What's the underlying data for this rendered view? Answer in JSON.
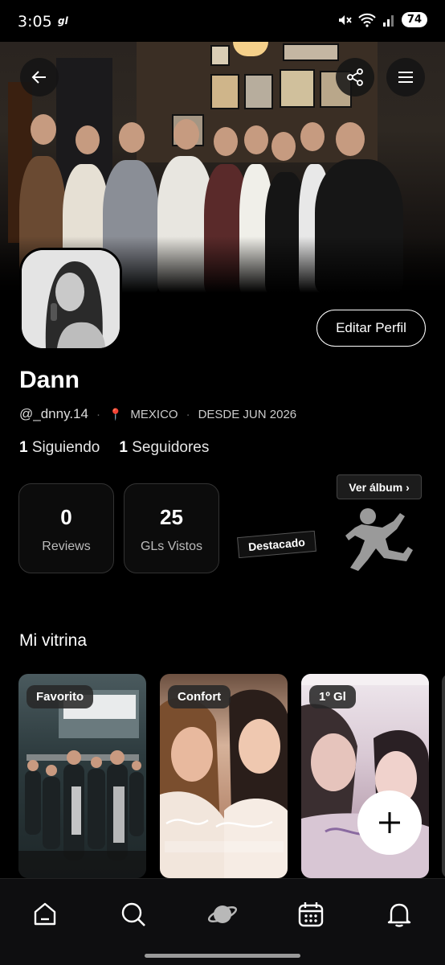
{
  "status_bar": {
    "time": "3:05",
    "app_badge": "gl",
    "battery": "74"
  },
  "header": {
    "back_icon": "arrow-left-icon",
    "share_icon": "share-icon",
    "menu_icon": "hamburger-icon"
  },
  "profile": {
    "name": "Dann",
    "handle": "@_dnny.14",
    "location": "MEXICO",
    "since": "DESDE JUN 2026",
    "following_count": "1",
    "following_label": "Siguiendo",
    "followers_count": "1",
    "followers_label": "Seguidores",
    "edit_label": "Editar Perfil"
  },
  "stats": [
    {
      "value": "0",
      "label": "Reviews"
    },
    {
      "value": "25",
      "label": "GLs Vistos"
    }
  ],
  "featured": {
    "badge": "Destacado",
    "album_label": "Ver álbum ›"
  },
  "showcase": {
    "title": "Mi vitrina",
    "cards": [
      {
        "tag": "Favorito"
      },
      {
        "tag": "Confort"
      },
      {
        "tag": "1º Gl"
      }
    ]
  },
  "nav": [
    "home-icon",
    "search-icon",
    "planet-icon",
    "calendar-icon",
    "bell-icon"
  ],
  "colors": {
    "background": "#000000",
    "accent_pin": "#e4453a",
    "card_border": "#333333"
  }
}
